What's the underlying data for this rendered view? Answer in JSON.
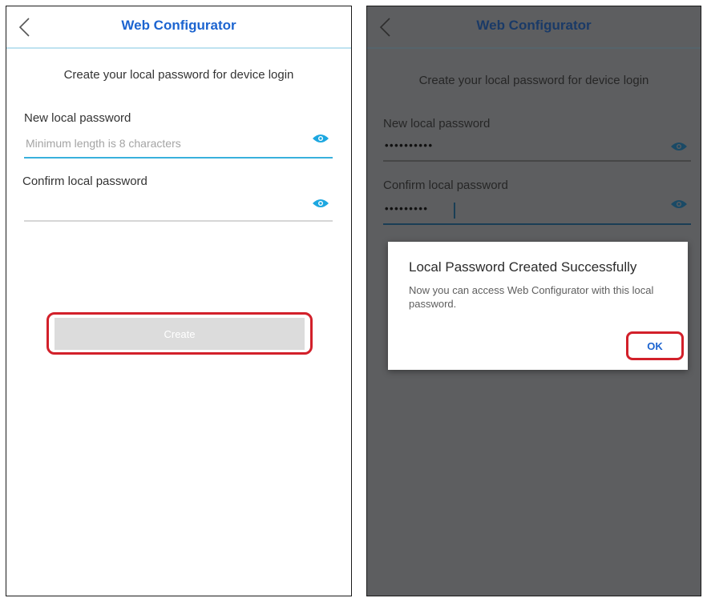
{
  "setup_screen": {
    "header": {
      "title": "Web Configurator"
    },
    "subtitle": "Create your local password for device login",
    "new_password": {
      "label": "New local password",
      "placeholder": "Minimum length is 8 characters"
    },
    "confirm_password": {
      "label": "Confirm local password",
      "value": ""
    },
    "create_button": {
      "label": "Create"
    }
  },
  "success_screen": {
    "header": {
      "title": "Web Configurator"
    },
    "subtitle": "Create your local password for device login",
    "new_password": {
      "label": "New local password",
      "value": "••••••••••"
    },
    "confirm_password": {
      "label": "Confirm local password",
      "value": "•••••••••"
    },
    "dialog": {
      "title": "Local Password Created Successfully",
      "message": "Now you can access Web Configurator with this local password.",
      "ok_label": "OK"
    }
  },
  "colors": {
    "accent": "#1c64d0",
    "eye_icon": "#1ca7e0",
    "highlight": "#d2202a",
    "overlay": "#5d5e60"
  }
}
